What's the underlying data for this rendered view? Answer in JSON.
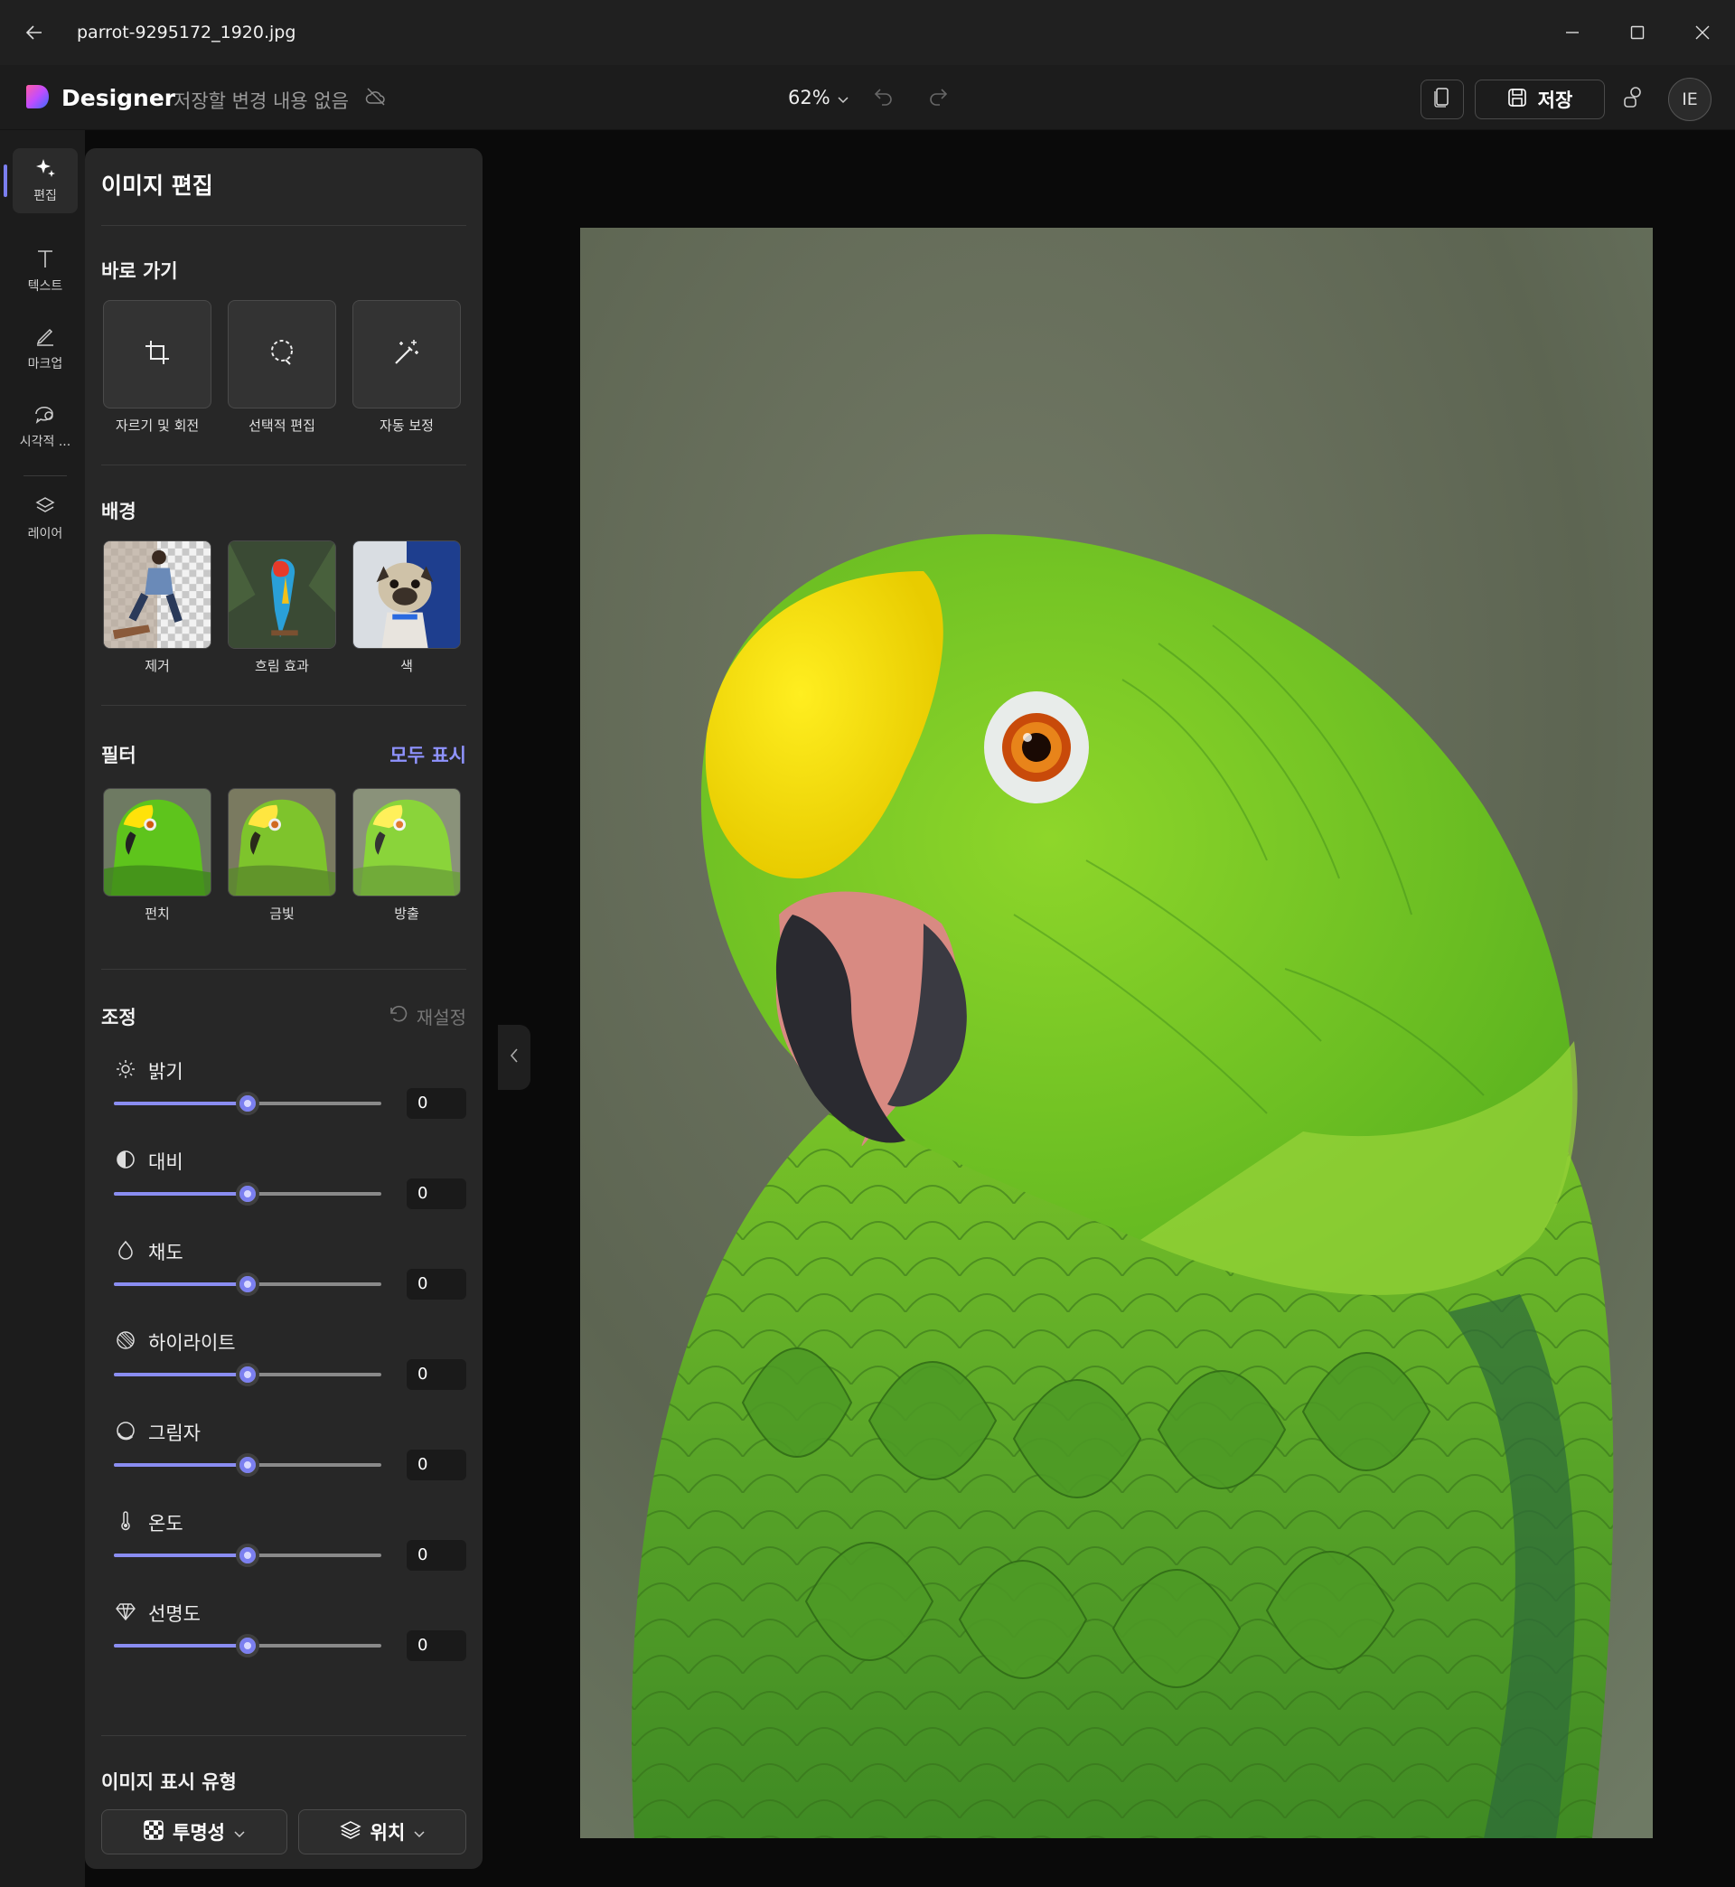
{
  "window": {
    "filename": "parrot-9295172_1920.jpg"
  },
  "header": {
    "brand": "Designer",
    "save_status": "저장할 변경 내용 없음",
    "zoom": "62%",
    "save_label": "저장",
    "avatar_initials": "IE"
  },
  "rail": {
    "items": [
      {
        "label": "편집",
        "icon": "sparkle-icon"
      },
      {
        "label": "텍스트",
        "icon": "text-icon"
      },
      {
        "label": "마크업",
        "icon": "pen-icon"
      },
      {
        "label": "시각적 ...",
        "icon": "visual-search-icon"
      },
      {
        "label": "레이어",
        "icon": "layers-icon"
      }
    ]
  },
  "panel": {
    "title": "이미지 편집",
    "shortcuts": {
      "title": "바로 가기",
      "items": [
        {
          "label": "자르기 및 회전",
          "icon": "crop-icon"
        },
        {
          "label": "선택적 편집",
          "icon": "lasso-icon"
        },
        {
          "label": "자동 보정",
          "icon": "magic-wand-icon"
        }
      ]
    },
    "background": {
      "title": "배경",
      "items": [
        {
          "label": "제거"
        },
        {
          "label": "흐림 효과"
        },
        {
          "label": "색"
        }
      ]
    },
    "filters": {
      "title": "필터",
      "show_all": "모두 표시",
      "items": [
        {
          "label": "펀치"
        },
        {
          "label": "금빛"
        },
        {
          "label": "방출"
        }
      ]
    },
    "adjust": {
      "title": "조정",
      "reset": "재설정",
      "items": [
        {
          "label": "밝기",
          "value": "0",
          "icon": "sun-icon",
          "level": 0.5
        },
        {
          "label": "대비",
          "value": "0",
          "icon": "contrast-icon",
          "level": 0.5
        },
        {
          "label": "채도",
          "value": "0",
          "icon": "drop-icon",
          "level": 0.5
        },
        {
          "label": "하이라이트",
          "value": "0",
          "icon": "highlight-icon",
          "level": 0.5
        },
        {
          "label": "그림자",
          "value": "0",
          "icon": "shadow-icon",
          "level": 0.5
        },
        {
          "label": "온도",
          "value": "0",
          "icon": "thermometer-icon",
          "level": 0.5
        },
        {
          "label": "선명도",
          "value": "0",
          "icon": "diamond-icon",
          "level": 0.5
        }
      ]
    },
    "display": {
      "title": "이미지 표시 유형",
      "opacity_label": "투명성",
      "position_label": "위치"
    }
  },
  "colors": {
    "accent": "#7b7ff0",
    "panel": "#272727",
    "link": "#8f93ff"
  }
}
